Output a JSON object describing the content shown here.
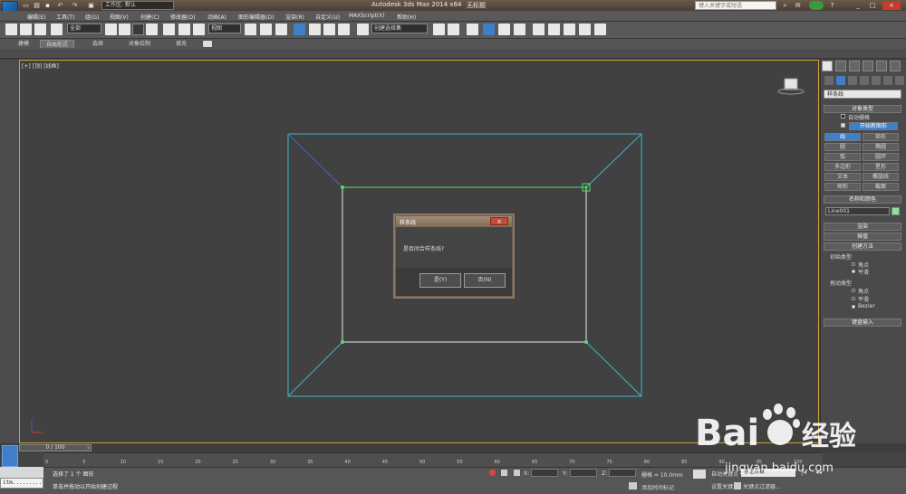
{
  "title_bar": {
    "workspace": "工作区: 默认",
    "app_title": "Autodesk 3ds Max  2014 x64",
    "doc_title": "无标题",
    "search_placeholder": "键入关键字或短语"
  },
  "menu": {
    "items": [
      "编辑(E)",
      "工具(T)",
      "组(G)",
      "视图(V)",
      "创建(C)",
      "修改器(O)",
      "动画(A)",
      "图形编辑器(D)",
      "渲染(R)",
      "自定义(U)",
      "MAXScript(X)",
      "帮助(H)"
    ]
  },
  "toolbar": {
    "filter_select": "全部",
    "ref_coord": "视图",
    "named_selection": "创建选择集"
  },
  "ribbon": {
    "tabs": [
      "建模",
      "自由形式",
      "选择",
      "对象绘制",
      "填充"
    ],
    "active_tab": 1
  },
  "viewport": {
    "label": "[+] [顶] [线框]"
  },
  "dialog": {
    "title": "样条线",
    "close": "×",
    "message": "是否闭合样条线?",
    "yes": "是(Y)",
    "no": "否(N)"
  },
  "command_panel": {
    "category": "样条线",
    "object_type_header": "对象类型",
    "auto_grid": "自动栅格",
    "start_new_shape": "开始新图形",
    "object_buttons": [
      "线",
      "矩形",
      "圆",
      "椭圆",
      "弧",
      "圆环",
      "多边形",
      "星形",
      "文本",
      "螺旋线",
      "卵形",
      "截面"
    ],
    "name_color_header": "名称和颜色",
    "object_name": "Line001",
    "object_color": "#8ce0a0",
    "render_header": "渲染",
    "interp_header": "插值",
    "creation_method_header": "创建方法",
    "initial_type": "初始类型",
    "initial_options": [
      "角点",
      "平滑"
    ],
    "drag_type": "拖动类型",
    "drag_options": [
      "角点",
      "平滑",
      "Bezier"
    ],
    "keyboard_header": "键盘输入"
  },
  "timeline": {
    "slider": "0 / 100",
    "ticks": [
      "0",
      "5",
      "10",
      "15",
      "20",
      "25",
      "30",
      "35",
      "40",
      "45",
      "50",
      "55",
      "60",
      "65",
      "70",
      "75",
      "80",
      "85",
      "90",
      "95",
      "100"
    ]
  },
  "status": {
    "line1": "选择了 1 个 图形",
    "line2": "单击并拖动以开始创建过程",
    "maxscript": "itm.........",
    "x_label": "X:",
    "y_label": "Y:",
    "z_label": "Z:",
    "grid": "栅格 = 10.0mm",
    "add_time_tag": "添加时间标记",
    "auto_key": "自动关键点",
    "set_key": "设置关键点",
    "selected": "选定对象",
    "key_filters": "关键点过滤器..."
  },
  "watermark": {
    "brand": "Bai",
    "brand2": "经验",
    "url": "jingyan.baidu.com"
  },
  "colors": {
    "viewport_border": "#c9a13b",
    "selection_blue": "#3f7fc9",
    "spline_green": "#55dd66",
    "frame_cyan": "#3bb6c8"
  }
}
